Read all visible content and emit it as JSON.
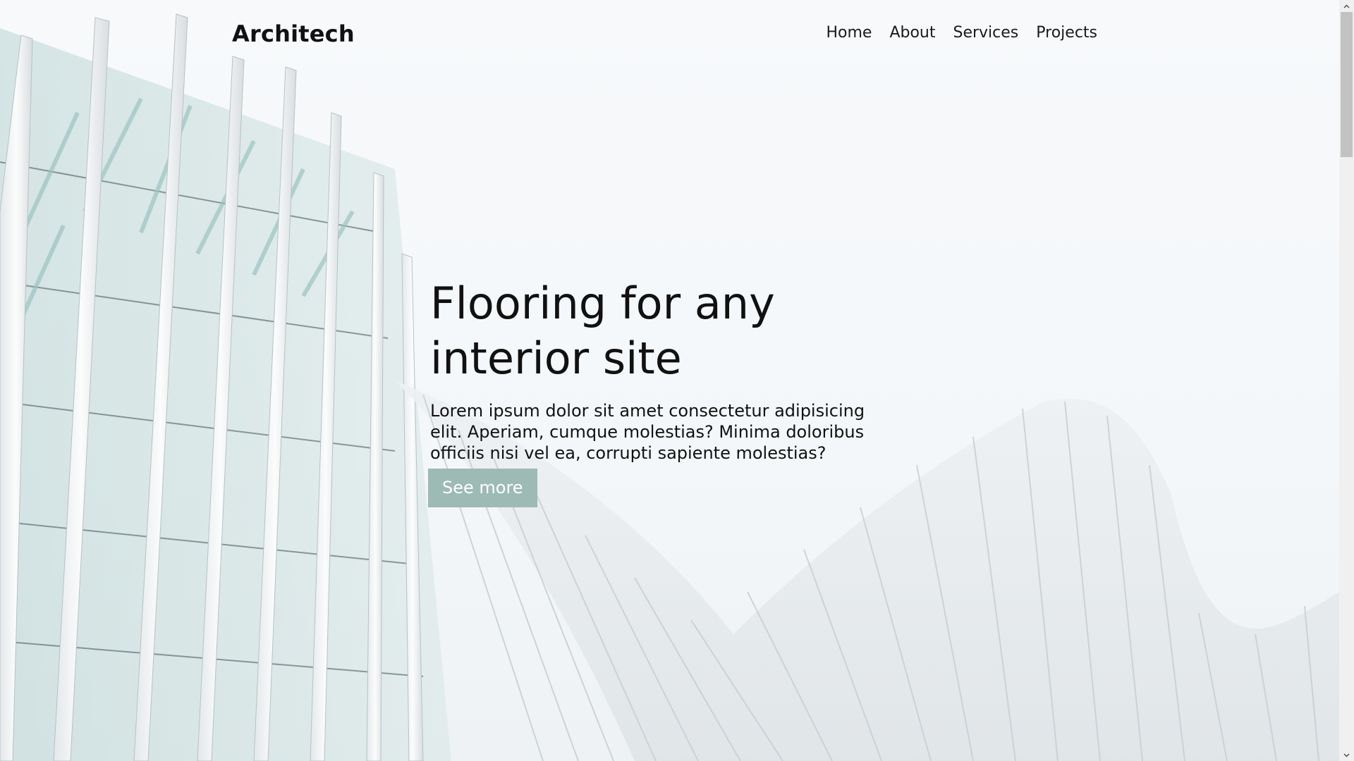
{
  "brand": {
    "name": "Architech"
  },
  "nav": {
    "items": [
      {
        "label": "Home"
      },
      {
        "label": "About"
      },
      {
        "label": "Services"
      },
      {
        "label": "Projects"
      }
    ]
  },
  "hero": {
    "title": "Flooring for any interior site",
    "text": "Lorem ipsum dolor sit amet consectetur adipisicing elit. Aperiam, cumque molestias? Minima doloribus officiis nisi vel ea, corrupti sapiente molestias?",
    "button_label": "See more",
    "background_image": "white-architecture-facade",
    "button_color": "#9dbab4"
  },
  "scrollbar": {
    "up_icon": "chevron-up-icon",
    "down_icon": "chevron-down-icon"
  }
}
